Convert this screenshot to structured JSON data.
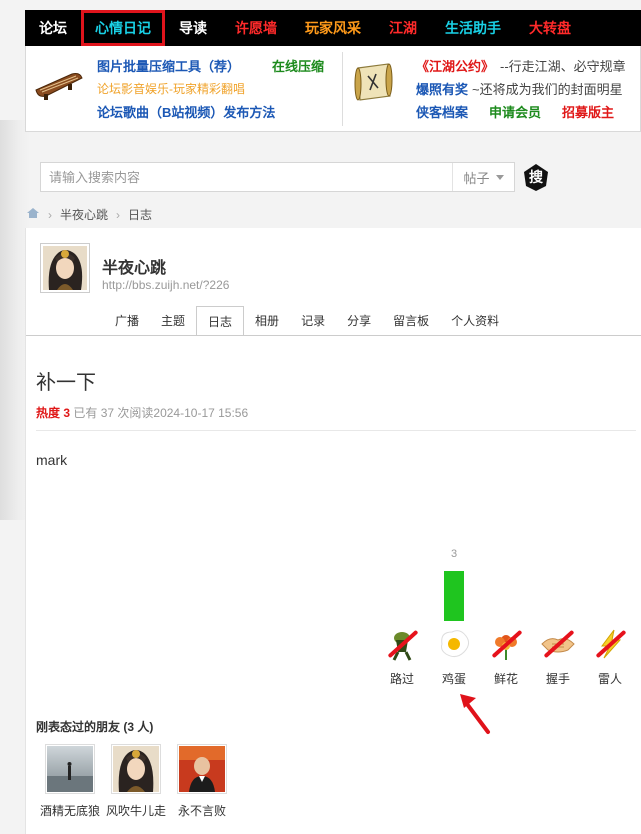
{
  "nav": {
    "items": [
      {
        "label": "论坛",
        "color": "#ffffff"
      },
      {
        "label": "心情日记",
        "color": "#19d1e6",
        "active": true
      },
      {
        "label": "导读",
        "color": "#ffffff"
      },
      {
        "label": "许愿墙",
        "color": "#ff2a2a"
      },
      {
        "label": "玩家风采",
        "color": "#ff9a1a"
      },
      {
        "label": "江湖",
        "color": "#ff2a2a"
      },
      {
        "label": "生活助手",
        "color": "#19d1e6"
      },
      {
        "label": "大转盘",
        "color": "#ff2a2a"
      }
    ]
  },
  "banner": {
    "left": {
      "link1": "图片批量压缩工具（荐）",
      "link2": "在线压缩",
      "link3": "论坛影音娱乐-玩家精彩翻唱",
      "link4": "论坛歌曲（B站视频）发布方法"
    },
    "right": {
      "pact": "《江湖公约》",
      "pact_desc": "--行走江湖、必守规章",
      "photo": "爆照有奖",
      "photo_desc": "~还将成为我们的封面明星",
      "archive": "侠客档案",
      "apply": "申请会员",
      "recruit": "招募版主"
    }
  },
  "search": {
    "placeholder": "请输入搜索内容",
    "type": "帖子",
    "button_icon": "search-seal-icon",
    "button_glyph": "搜"
  },
  "breadcrumb": {
    "home_icon": "home-icon",
    "items": [
      "半夜心跳",
      "日志"
    ]
  },
  "profile": {
    "name": "半夜心跳",
    "url": "http://bbs.zuijh.net/?226"
  },
  "tabs": [
    "广播",
    "主题",
    "日志",
    "相册",
    "记录",
    "分享",
    "留言板",
    "个人资料"
  ],
  "active_tab": "日志",
  "post": {
    "title": "补一下",
    "heat_label": "热度",
    "heat_value": "3",
    "meta": "已有 37 次阅读2024-10-17 15:56",
    "body": "mark"
  },
  "reactions": {
    "count_label": "3",
    "items": [
      {
        "label": "路过",
        "icon": "passerby-icon",
        "disabled": true
      },
      {
        "label": "鸡蛋",
        "icon": "egg-icon",
        "disabled": false
      },
      {
        "label": "鲜花",
        "icon": "flower-icon",
        "disabled": true
      },
      {
        "label": "握手",
        "icon": "handshake-icon",
        "disabled": true
      },
      {
        "label": "雷人",
        "icon": "lightning-icon",
        "disabled": true
      }
    ]
  },
  "friends": {
    "title": "刚表态过的朋友 (3 人)",
    "items": [
      {
        "name": "酒精无底狼"
      },
      {
        "name": "风吹牛儿走"
      },
      {
        "name": "永不言败"
      }
    ]
  }
}
